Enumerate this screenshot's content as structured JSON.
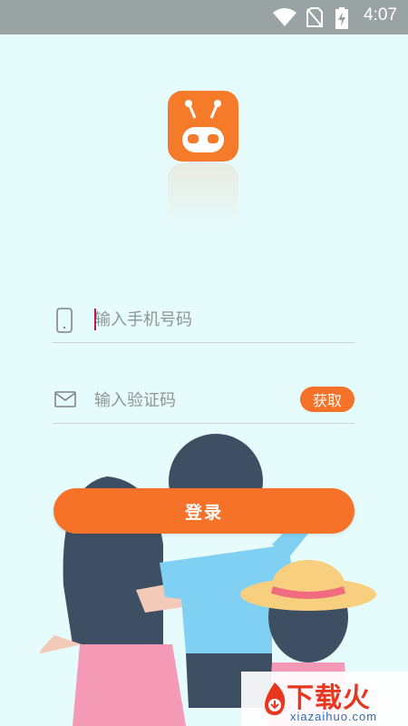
{
  "status_bar": {
    "time": "4:07",
    "icons": [
      "wifi-icon",
      "no-sim-icon",
      "battery-charging-icon"
    ]
  },
  "app": {
    "logo_icon": "robot-logo-icon",
    "accent_color": "#f57228",
    "background_color": "#e6fbfb"
  },
  "form": {
    "phone": {
      "icon": "phone-icon",
      "placeholder": "输入手机号码",
      "value": ""
    },
    "code": {
      "icon": "mail-icon",
      "placeholder": "输入验证码",
      "value": "",
      "get_code_label": "获取"
    },
    "login_label": "登录"
  },
  "watermark": {
    "title": "下载火",
    "subtitle": "xiazaihuo.com"
  }
}
